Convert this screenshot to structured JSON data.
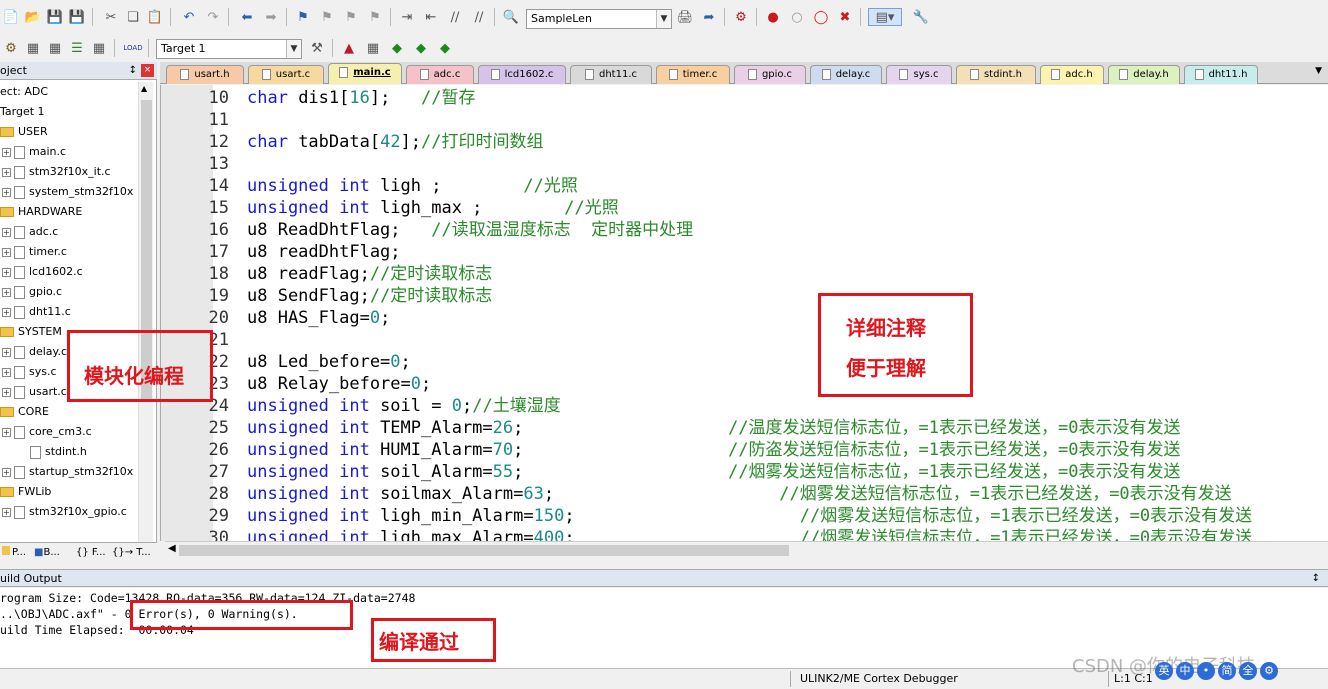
{
  "toolbar1": {
    "target_combo": "SampleLen"
  },
  "toolbar2": {
    "target_select": "Target 1"
  },
  "project": {
    "header": "oject",
    "pin": "↕",
    "close": "×",
    "items": [
      {
        "label": "ect: ADC",
        "type": "root"
      },
      {
        "label": "Target 1",
        "type": "target"
      },
      {
        "label": "USER",
        "type": "group"
      },
      {
        "label": "main.c",
        "type": "file"
      },
      {
        "label": "stm32f10x_it.c",
        "type": "file"
      },
      {
        "label": "system_stm32f10x",
        "type": "file"
      },
      {
        "label": "HARDWARE",
        "type": "group"
      },
      {
        "label": "adc.c",
        "type": "file"
      },
      {
        "label": "timer.c",
        "type": "file"
      },
      {
        "label": "lcd1602.c",
        "type": "file"
      },
      {
        "label": "gpio.c",
        "type": "file"
      },
      {
        "label": "dht11.c",
        "type": "file"
      },
      {
        "label": "SYSTEM",
        "type": "group"
      },
      {
        "label": "delay.c",
        "type": "file"
      },
      {
        "label": "sys.c",
        "type": "file"
      },
      {
        "label": "usart.c",
        "type": "file"
      },
      {
        "label": "CORE",
        "type": "group"
      },
      {
        "label": "core_cm3.c",
        "type": "file"
      },
      {
        "label": "stdint.h",
        "type": "subfile"
      },
      {
        "label": "startup_stm32f10x",
        "type": "file"
      },
      {
        "label": "FWLib",
        "type": "group"
      },
      {
        "label": "stm32f10x_gpio.c",
        "type": "file"
      }
    ],
    "tabs": [
      "P...",
      "B...",
      "{} F...",
      "{}→ T..."
    ]
  },
  "editor_tabs": [
    {
      "label": "usart.h",
      "color": "#f6c9a8"
    },
    {
      "label": "usart.c",
      "color": "#f6d9a0"
    },
    {
      "label": "main.c",
      "color": "#f6f0b0",
      "active": true
    },
    {
      "label": "adc.c",
      "color": "#f4c2c8"
    },
    {
      "label": "lcd1602.c",
      "color": "#d6c3ea"
    },
    {
      "label": "dht11.c",
      "color": "#d9d9d9"
    },
    {
      "label": "timer.c",
      "color": "#f8cfa0"
    },
    {
      "label": "gpio.c",
      "color": "#ead0e6"
    },
    {
      "label": "delay.c",
      "color": "#cfdcef"
    },
    {
      "label": "sys.c",
      "color": "#e4d4ee"
    },
    {
      "label": "stdint.h",
      "color": "#f3e0b8"
    },
    {
      "label": "adc.h",
      "color": "#fbf3b0"
    },
    {
      "label": "delay.h",
      "color": "#dcf0c0"
    },
    {
      "label": "dht11.h",
      "color": "#c6ecec"
    }
  ],
  "code_lines": [
    {
      "n": "10",
      "parts": [
        {
          "t": "char",
          "c": "kw"
        },
        {
          "t": " dis1[",
          "c": "code"
        },
        {
          "t": "16",
          "c": "num"
        },
        {
          "t": "];   ",
          "c": "code"
        },
        {
          "t": "//暂存",
          "c": "cm"
        }
      ]
    },
    {
      "n": "11",
      "parts": []
    },
    {
      "n": "12",
      "parts": [
        {
          "t": "char",
          "c": "kw"
        },
        {
          "t": " tabData[",
          "c": "code"
        },
        {
          "t": "42",
          "c": "num"
        },
        {
          "t": "];",
          "c": "code"
        },
        {
          "t": "//打印时间数组",
          "c": "cm"
        }
      ]
    },
    {
      "n": "13",
      "parts": []
    },
    {
      "n": "14",
      "parts": [
        {
          "t": "unsigned int",
          "c": "kw"
        },
        {
          "t": " ligh ;        ",
          "c": "code"
        },
        {
          "t": "//光照",
          "c": "cm"
        }
      ]
    },
    {
      "n": "15",
      "parts": [
        {
          "t": "unsigned int",
          "c": "kw"
        },
        {
          "t": " ligh_max ;        ",
          "c": "code"
        },
        {
          "t": "//光照",
          "c": "cm"
        }
      ]
    },
    {
      "n": "16",
      "parts": [
        {
          "t": "u8 ReadDhtFlag;   ",
          "c": "code"
        },
        {
          "t": "//读取温湿度标志  定时器中处理",
          "c": "cm"
        }
      ]
    },
    {
      "n": "17",
      "parts": [
        {
          "t": "u8 readDhtFlag;",
          "c": "code"
        }
      ]
    },
    {
      "n": "18",
      "parts": [
        {
          "t": "u8 readFlag;",
          "c": "code"
        },
        {
          "t": "//定时读取标志",
          "c": "cm"
        }
      ]
    },
    {
      "n": "19",
      "parts": [
        {
          "t": "u8 SendFlag;",
          "c": "code"
        },
        {
          "t": "//定时读取标志",
          "c": "cm"
        }
      ]
    },
    {
      "n": "20",
      "parts": [
        {
          "t": "u8 HAS_Flag=",
          "c": "code"
        },
        {
          "t": "0",
          "c": "num"
        },
        {
          "t": ";",
          "c": "code"
        }
      ]
    },
    {
      "n": "21",
      "parts": []
    },
    {
      "n": "22",
      "parts": [
        {
          "t": "u8 Led_before=",
          "c": "code"
        },
        {
          "t": "0",
          "c": "num"
        },
        {
          "t": ";",
          "c": "code"
        }
      ]
    },
    {
      "n": "23",
      "parts": [
        {
          "t": "u8 Relay_before=",
          "c": "code"
        },
        {
          "t": "0",
          "c": "num"
        },
        {
          "t": ";",
          "c": "code"
        }
      ]
    },
    {
      "n": "24",
      "parts": [
        {
          "t": "unsigned int",
          "c": "kw"
        },
        {
          "t": " soil = ",
          "c": "code"
        },
        {
          "t": "0",
          "c": "num"
        },
        {
          "t": ";",
          "c": "code"
        },
        {
          "t": "//土壤湿度",
          "c": "cm"
        }
      ]
    },
    {
      "n": "25",
      "parts": [
        {
          "t": "unsigned int",
          "c": "kw"
        },
        {
          "t": " TEMP_Alarm=",
          "c": "code"
        },
        {
          "t": "26",
          "c": "num"
        },
        {
          "t": ";                    ",
          "c": "code"
        },
        {
          "t": "//温度发送短信标志位，=1表示已经发送，=0表示没有发送",
          "c": "cm"
        }
      ]
    },
    {
      "n": "26",
      "parts": [
        {
          "t": "unsigned int",
          "c": "kw"
        },
        {
          "t": " HUMI_Alarm=",
          "c": "code"
        },
        {
          "t": "70",
          "c": "num"
        },
        {
          "t": ";                    ",
          "c": "code"
        },
        {
          "t": "//防盗发送短信标志位，=1表示已经发送，=0表示没有发送",
          "c": "cm"
        }
      ]
    },
    {
      "n": "27",
      "parts": [
        {
          "t": "unsigned int",
          "c": "kw"
        },
        {
          "t": " soil_Alarm=",
          "c": "code"
        },
        {
          "t": "55",
          "c": "num"
        },
        {
          "t": ";                    ",
          "c": "code"
        },
        {
          "t": "//烟雾发送短信标志位，=1表示已经发送，=0表示没有发送",
          "c": "cm"
        }
      ]
    },
    {
      "n": "28",
      "parts": [
        {
          "t": "unsigned int",
          "c": "kw"
        },
        {
          "t": " soilmax_Alarm=",
          "c": "code"
        },
        {
          "t": "63",
          "c": "num"
        },
        {
          "t": ";                      ",
          "c": "code"
        },
        {
          "t": "//烟雾发送短信标志位，=1表示已经发送，=0表示没有发送",
          "c": "cm"
        }
      ]
    },
    {
      "n": "29",
      "parts": [
        {
          "t": "unsigned int",
          "c": "kw"
        },
        {
          "t": " ligh_min_Alarm=",
          "c": "code"
        },
        {
          "t": "150",
          "c": "num"
        },
        {
          "t": ";                      ",
          "c": "code"
        },
        {
          "t": "//烟雾发送短信标志位，=1表示已经发送，=0表示没有发送",
          "c": "cm"
        }
      ]
    },
    {
      "n": "30",
      "parts": [
        {
          "t": "unsigned int",
          "c": "kw"
        },
        {
          "t": " ligh_max_Alarm=",
          "c": "code"
        },
        {
          "t": "400",
          "c": "num"
        },
        {
          "t": ";                      ",
          "c": "code"
        },
        {
          "t": "//烟雾发送短信标志位，=1表示已经发送，=0表示没有发送",
          "c": "cm"
        }
      ]
    }
  ],
  "build": {
    "header": "uild Output",
    "pin": "↕",
    "lines": [
      "rogram Size: Code=13428 RO-data=356 RW-data=124 ZI-data=2748",
      "..\\OBJ\\ADC.axf\" - 0 Error(s), 0 Warning(s).",
      "uild Time Elapsed:  00:00:04"
    ]
  },
  "status": {
    "debugger": "ULINK2/ME Cortex Debugger",
    "position": "L:1 C:1"
  },
  "annotations": {
    "modular": "模块化编程",
    "comment_line1": "详细注释",
    "comment_line2": "便于理解",
    "compiled": "编译通过",
    "color": "#e0161c"
  },
  "watermark": "CSDN @你的电子科技",
  "ime": [
    "英",
    "中",
    "•",
    "简",
    "全",
    "⚙"
  ],
  "icons": {
    "new": "new-file-icon",
    "open": "open-icon",
    "save": "save-icon",
    "saveall": "save-all-icon",
    "cut": "cut-icon",
    "copy": "copy-icon",
    "paste": "paste-icon",
    "undo": "undo-icon",
    "redo": "redo-icon",
    "back": "back-icon",
    "forward": "forward-icon",
    "bookmark": "bookmark-icon",
    "indent": "indent-icon",
    "unindent": "unindent-icon",
    "comment": "comment-icon",
    "uncomment": "uncomment-icon",
    "find": "find-icon",
    "debug": "debug-icon",
    "breakpoint": "breakpoint-icon",
    "build": "build-icon",
    "rebuild": "rebuild-icon",
    "download": "download-icon",
    "options": "options-icon"
  }
}
